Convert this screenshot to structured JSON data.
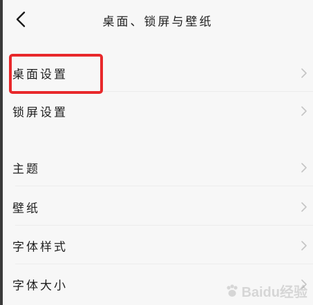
{
  "header": {
    "title": "桌面、锁屏与壁纸",
    "back_icon": "chevron-left-icon"
  },
  "section1": {
    "items": [
      {
        "label": "桌面设置",
        "icon": "chevron-right-icon"
      },
      {
        "label": "锁屏设置",
        "icon": "chevron-right-icon"
      }
    ]
  },
  "section2": {
    "items": [
      {
        "label": "主题",
        "icon": "chevron-right-icon"
      },
      {
        "label": "壁纸",
        "icon": "chevron-right-icon"
      },
      {
        "label": "字体样式",
        "icon": "chevron-right-icon"
      },
      {
        "label": "字体大小",
        "icon": "chevron-right-icon"
      }
    ]
  },
  "annotation": {
    "highlight_color": "#e8282b"
  },
  "colors": {
    "background": "#f7f7f7",
    "chevron": "#c4c4c4",
    "divider": "#ececec"
  },
  "watermark": {
    "text": "Baidu经验"
  }
}
